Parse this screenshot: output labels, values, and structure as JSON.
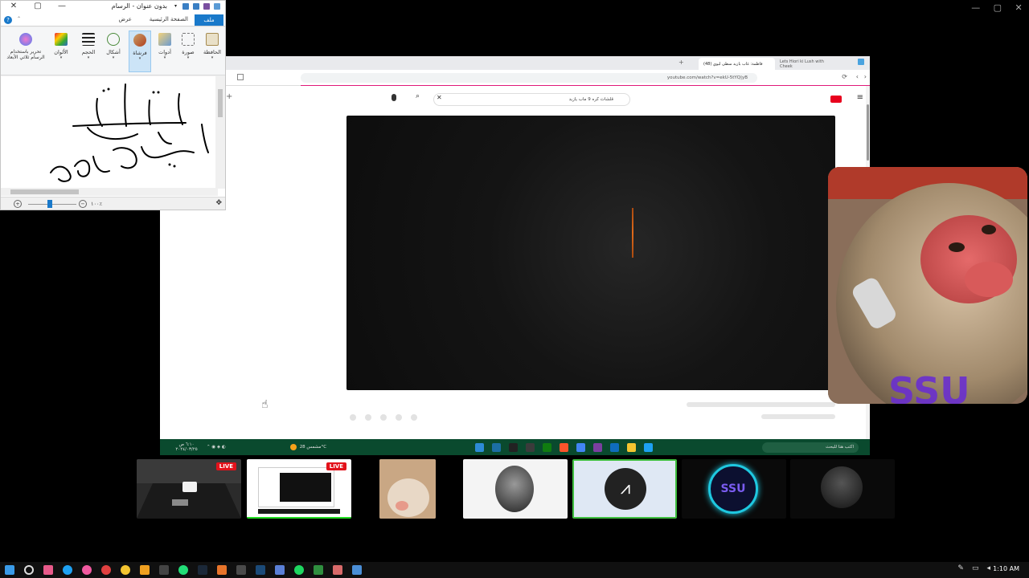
{
  "paint": {
    "title": "بدون عنوان - الرسام",
    "tabs": {
      "file": "ملف",
      "home": "الصفحة الرئيسية",
      "view": "عرض"
    },
    "ribbon": [
      {
        "label": "الحافظة",
        "icon": "clipboard-icon"
      },
      {
        "label": "صورة",
        "icon": "image-icon"
      },
      {
        "label": "أدوات",
        "icon": "tools-icon"
      },
      {
        "label": "فرشاة",
        "icon": "brush-icon"
      },
      {
        "label": "أشكال",
        "icon": "shapes-icon"
      },
      {
        "label": "الحجم",
        "icon": "size-icon"
      },
      {
        "label": "الألوان",
        "icon": "colors-icon"
      },
      {
        "label": "تحرير باستخدام الرسام ثلاثي الأبعاد",
        "icon": "paint3d-icon"
      }
    ],
    "zoom": "١٠٠٪",
    "help": "?"
  },
  "browser": {
    "tabs": [
      {
        "label": "Lets Hiori ki Lush with Cheek"
      },
      {
        "label": "(48) فاطمة: غاب بازيد سطى لبوي"
      }
    ],
    "url": "youtube.com/watch?v=ekU-5tYQ|yB",
    "search_query": "قلشات كره 9 ماب يازيد"
  },
  "inner_taskbar": {
    "search_placeholder": "اكتب هنا للبحث",
    "weather": "مشمس 28°C",
    "time": "٦:١٠ ص",
    "date": "٢٠٢٤/٠٣/٢٥"
  },
  "tiles": [
    {
      "name": "racing-game-stream",
      "live": "LIVE"
    },
    {
      "name": "screen-share-stream",
      "live": "LIVE"
    },
    {
      "name": "cat-stream",
      "live": ""
    },
    {
      "name": "king-avatar",
      "live": ""
    },
    {
      "name": "logo-avatar",
      "live": ""
    },
    {
      "name": "ssu-avatar",
      "live": ""
    },
    {
      "name": "dark-avatar",
      "live": ""
    }
  ],
  "taskbar": {
    "clock": "1:10 AM"
  },
  "colors": {
    "accent": "#1979ca",
    "live": "#e3121b",
    "inner_taskbar": "#0a4a2e"
  }
}
